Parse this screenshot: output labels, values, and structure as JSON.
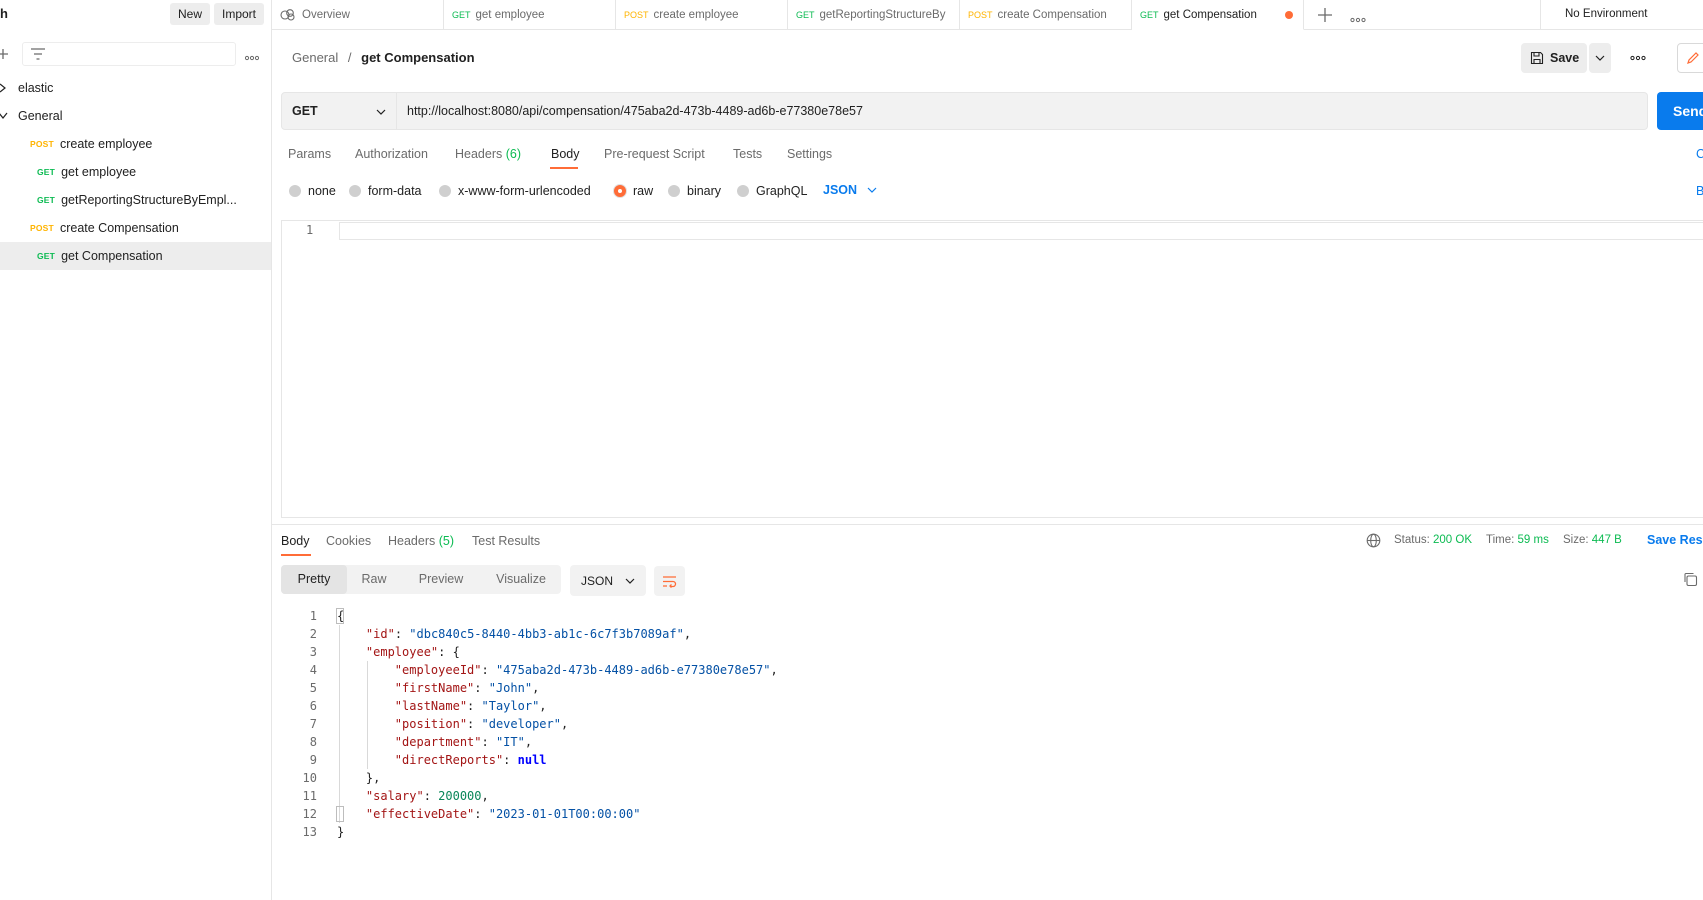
{
  "sidebar": {
    "title": "h",
    "new_label": "New",
    "import_label": "Import",
    "tree": [
      {
        "label": "elastic",
        "type": "folder",
        "expanded": false
      },
      {
        "label": "General",
        "type": "folder",
        "expanded": true
      },
      {
        "method": "POST",
        "label": "create employee"
      },
      {
        "method": "GET",
        "label": "get employee"
      },
      {
        "method": "GET",
        "label": "getReportingStructureByEmpl..."
      },
      {
        "method": "POST",
        "label": "create Compensation"
      },
      {
        "method": "GET",
        "label": "get Compensation",
        "active": true
      }
    ]
  },
  "tabs": [
    {
      "label": "Overview"
    },
    {
      "method": "GET",
      "label": "get employee"
    },
    {
      "method": "POST",
      "label": "create employee"
    },
    {
      "method": "GET",
      "label": "getReportingStructureBy"
    },
    {
      "method": "POST",
      "label": "create Compensation"
    },
    {
      "method": "GET",
      "label": "get Compensation",
      "active": true,
      "unsaved": true
    }
  ],
  "environment": "No Environment",
  "breadcrumb": {
    "parent": "General",
    "separator": "/",
    "current": "get Compensation"
  },
  "save_label": "Save",
  "request": {
    "method": "GET",
    "url": "http://localhost:8080/api/compensation/475aba2d-473b-4489-ad6b-e77380e78e57",
    "send_label": "Send",
    "tabs": {
      "params": "Params",
      "authorization": "Authorization",
      "headers": "Headers",
      "headers_count": "(6)",
      "body": "Body",
      "prerequest": "Pre-request Script",
      "tests": "Tests",
      "settings": "Settings"
    },
    "cookies_label": "C",
    "body_types": {
      "none": "none",
      "form_data": "form-data",
      "urlencoded": "x-www-form-urlencoded",
      "raw": "raw",
      "binary": "binary",
      "graphql": "GraphQL",
      "selected": "raw"
    },
    "format": "JSON",
    "beautify_label": "B",
    "editor_line": "1"
  },
  "response": {
    "tabs": {
      "body": "Body",
      "cookies": "Cookies",
      "headers": "Headers",
      "headers_count": "(5)",
      "test_results": "Test Results"
    },
    "status_label": "Status:",
    "status_value": "200 OK",
    "time_label": "Time:",
    "time_value": "59 ms",
    "size_label": "Size:",
    "size_value": "447 B",
    "save_response_label": "Save Resp",
    "views": {
      "pretty": "Pretty",
      "raw": "Raw",
      "preview": "Preview",
      "visualize": "Visualize"
    },
    "format": "JSON",
    "body": {
      "open": "{",
      "id_key": "\"id\"",
      "id_val": "\"dbc840c5-8440-4bb3-ab1c-6c7f3b7089af\"",
      "employee_key": "\"employee\"",
      "employeeId_key": "\"employeeId\"",
      "employeeId_val": "\"475aba2d-473b-4489-ad6b-e77380e78e57\"",
      "firstName_key": "\"firstName\"",
      "firstName_val": "\"John\"",
      "lastName_key": "\"lastName\"",
      "lastName_val": "\"Taylor\"",
      "position_key": "\"position\"",
      "position_val": "\"developer\"",
      "department_key": "\"department\"",
      "department_val": "\"IT\"",
      "directReports_key": "\"directReports\"",
      "directReports_val": "null",
      "salary_key": "\"salary\"",
      "salary_val": "200000",
      "effectiveDate_key": "\"effectiveDate\"",
      "effectiveDate_val": "\"2023-01-01T00:00:00\"",
      "close": "}"
    },
    "line_numbers": [
      "1",
      "2",
      "3",
      "4",
      "5",
      "6",
      "7",
      "8",
      "9",
      "10",
      "11",
      "12",
      "13"
    ]
  },
  "colors": {
    "accent": "#ff6c37",
    "primary": "#097bed",
    "get": "#0cbb52",
    "post": "#ffb400"
  }
}
